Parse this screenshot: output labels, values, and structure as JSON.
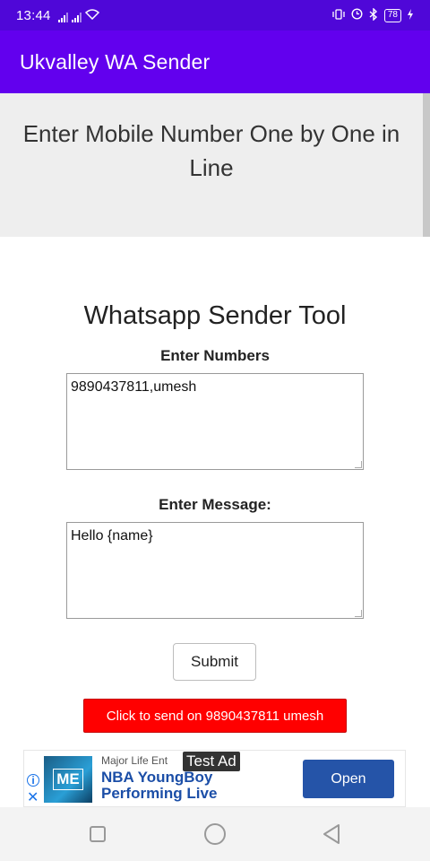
{
  "status_bar": {
    "time": "13:44",
    "battery": "78",
    "icons": [
      "signal-icon",
      "mobile-data-icon",
      "wifi-icon",
      "vibrate-icon",
      "alarm-icon",
      "bluetooth-icon",
      "battery-icon",
      "charging-icon"
    ]
  },
  "app_bar": {
    "title": "Ukvalley WA Sender"
  },
  "banner": {
    "text": "Enter Mobile Number One by One in Line"
  },
  "tool": {
    "title": "Whatsapp Sender Tool",
    "numbers_label": "Enter Numbers",
    "numbers_value": "9890437811,umesh",
    "message_label": "Enter Message:",
    "message_value": "Hello {name}",
    "submit_label": "Submit",
    "send_link_label": "Click to send on 9890437811 umesh"
  },
  "ad": {
    "logo_text": "ME",
    "brand": "Major Life Ent",
    "headline": "NBA YoungBoy Performing Live",
    "test_badge": "Test Ad",
    "cta": "Open"
  },
  "colors": {
    "status_bar": "#4f07d8",
    "app_bar": "#6200ee",
    "send_button": "#ff0000",
    "ad_cta": "#2554a8"
  }
}
